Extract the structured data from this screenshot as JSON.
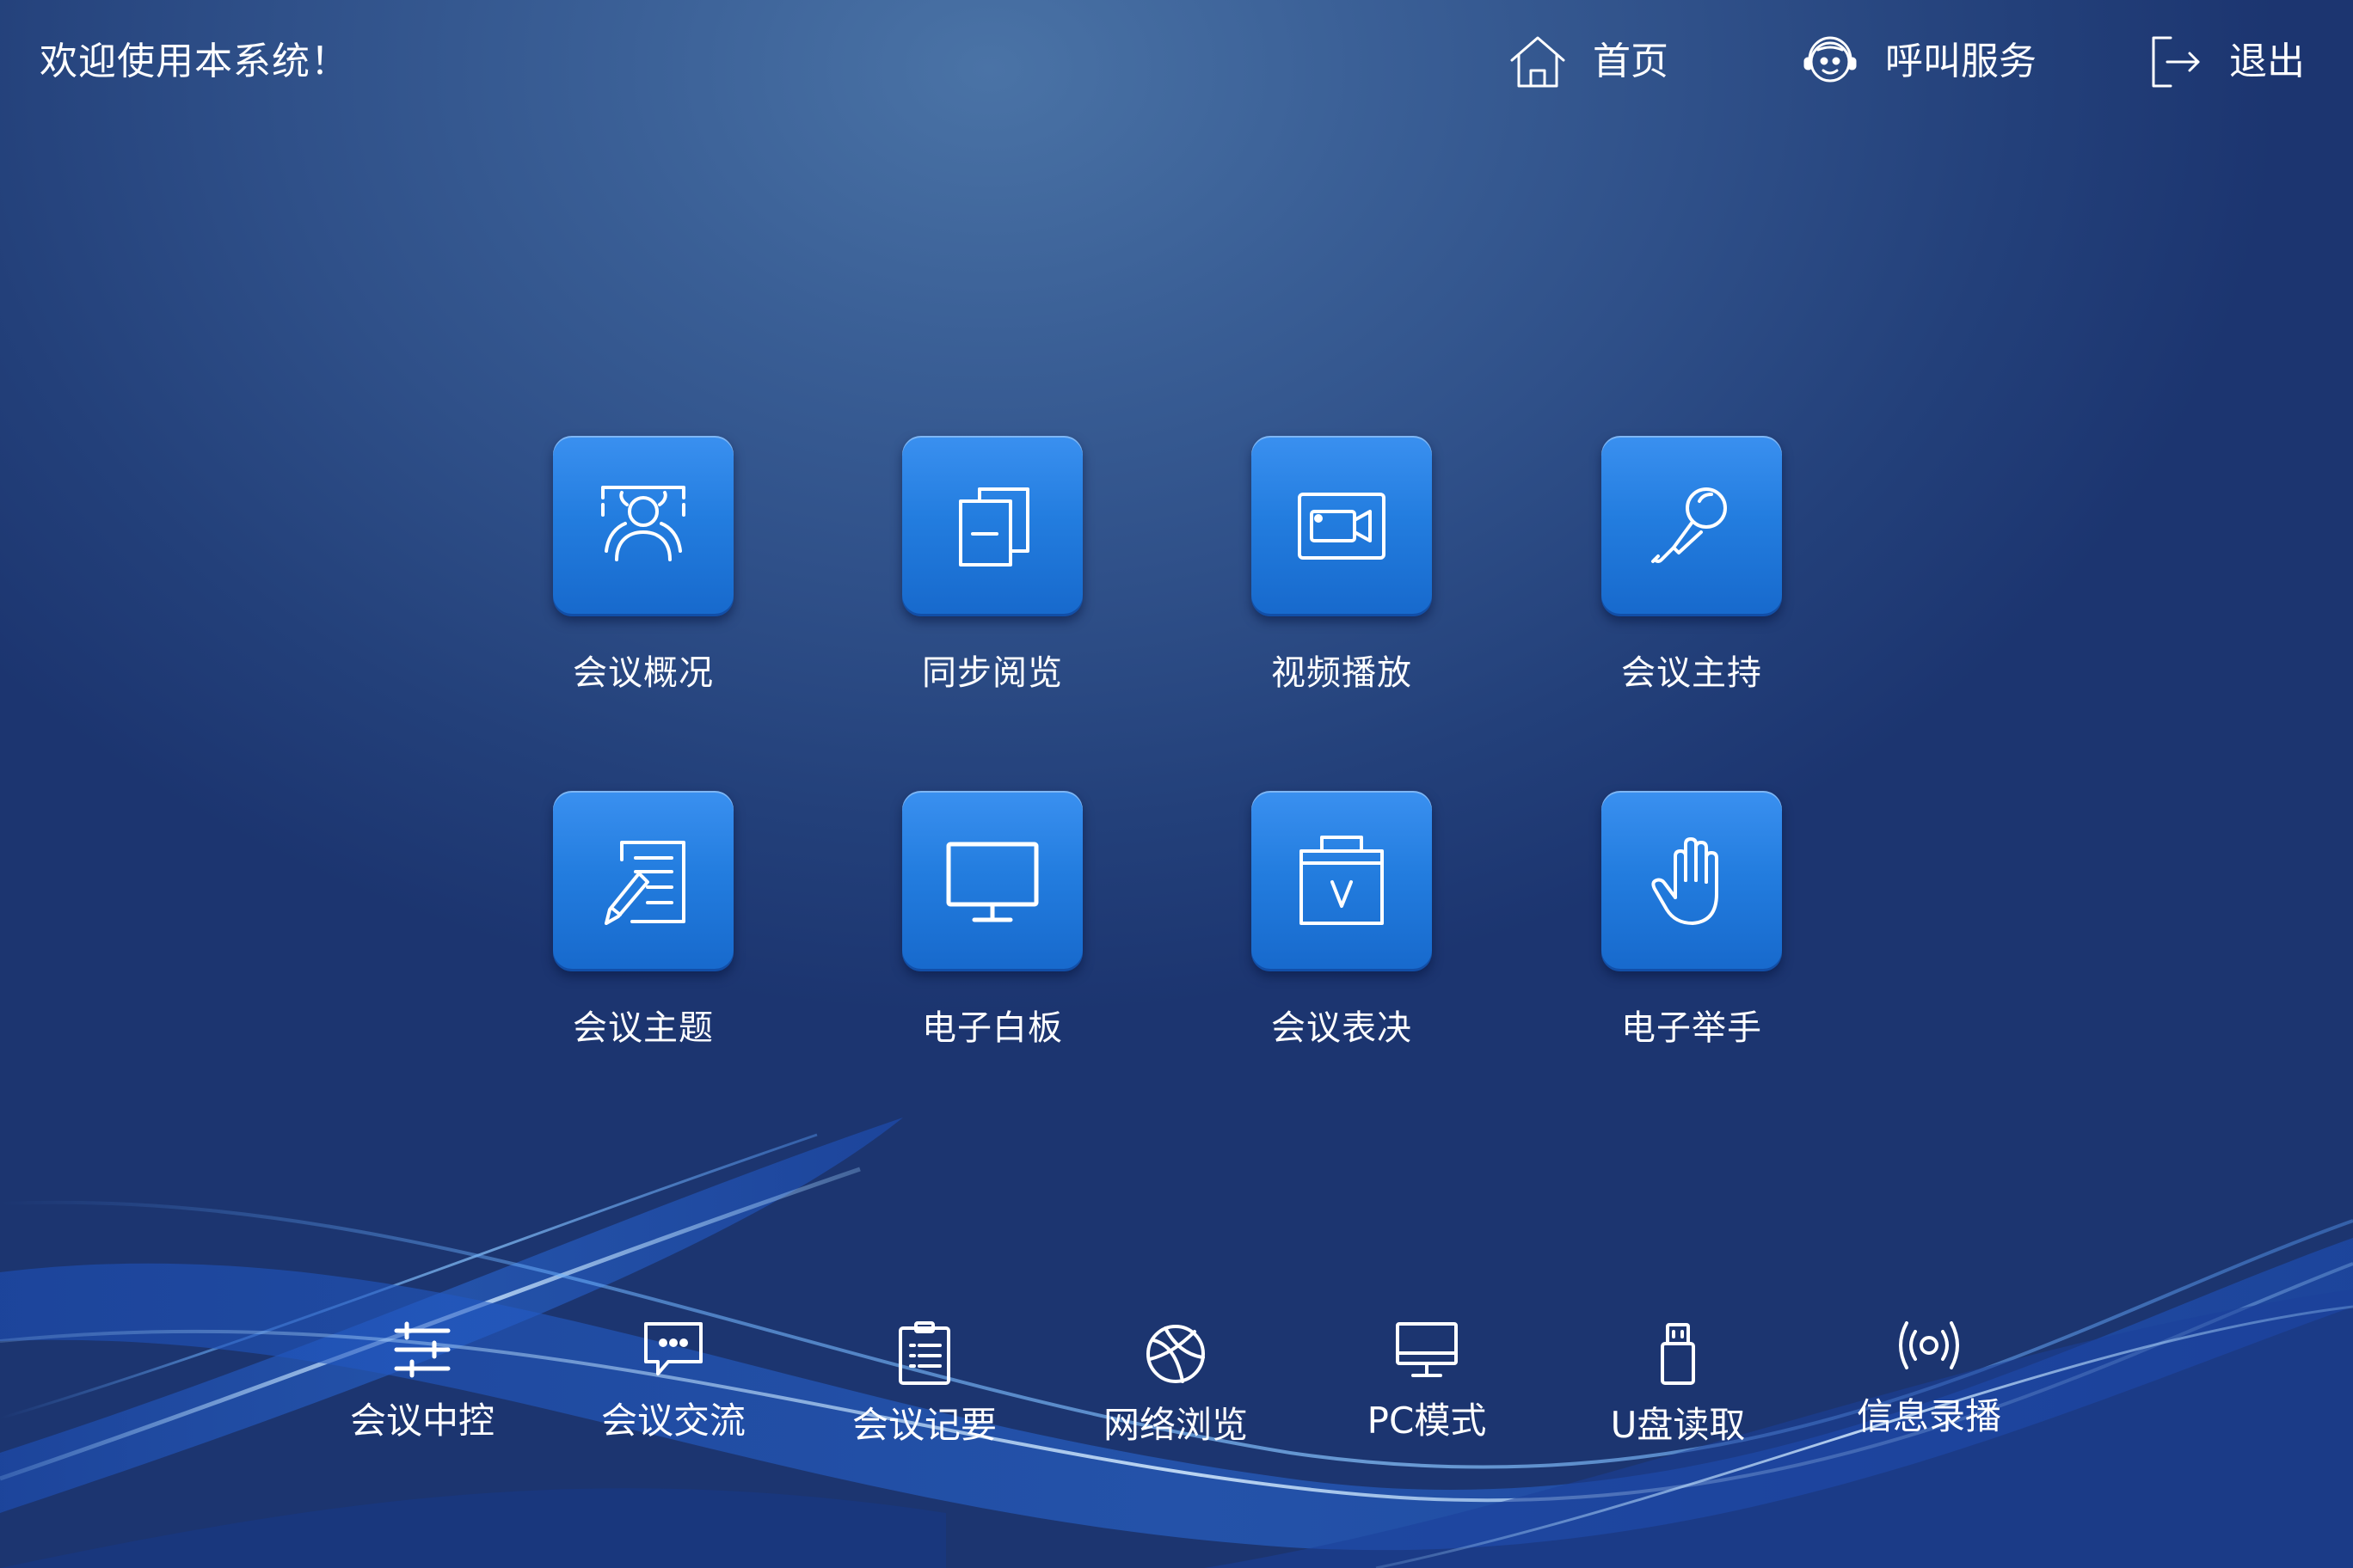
{
  "header": {
    "welcome": "欢迎使用本系统！",
    "nav": [
      {
        "label": "首页",
        "icon": "home-icon"
      },
      {
        "label": "呼叫服务",
        "icon": "service-call-icon"
      },
      {
        "label": "退出",
        "icon": "logout-icon"
      }
    ]
  },
  "tiles": [
    {
      "label": "会议概况",
      "icon": "meeting-overview-icon"
    },
    {
      "label": "同步阅览",
      "icon": "sync-documents-icon"
    },
    {
      "label": "视频播放",
      "icon": "video-camera-icon"
    },
    {
      "label": "会议主持",
      "icon": "microphone-icon"
    },
    {
      "label": "会议主题",
      "icon": "topic-document-icon"
    },
    {
      "label": "电子白板",
      "icon": "whiteboard-monitor-icon"
    },
    {
      "label": "会议表决",
      "icon": "vote-box-icon"
    },
    {
      "label": "电子举手",
      "icon": "raise-hand-icon"
    }
  ],
  "dock": [
    {
      "label": "会议中控",
      "icon": "control-sliders-icon"
    },
    {
      "label": "会议交流",
      "icon": "chat-bubble-icon"
    },
    {
      "label": "会议记要",
      "icon": "clipboard-notes-icon"
    },
    {
      "label": "网络浏览",
      "icon": "globe-icon"
    },
    {
      "label": "PC模式",
      "icon": "desktop-monitor-icon"
    },
    {
      "label": "U盘读取",
      "icon": "usb-drive-icon"
    },
    {
      "label": "信息录播",
      "icon": "broadcast-icon"
    }
  ],
  "colors": {
    "background": "#2f5089",
    "tile": "#237ddf",
    "text": "#ffffff"
  }
}
